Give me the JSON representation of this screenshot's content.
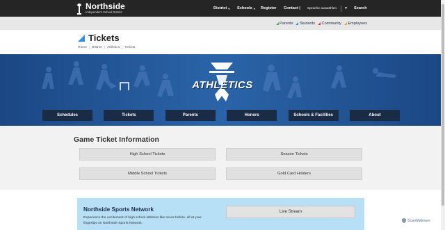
{
  "header": {
    "logo_name": "Northside",
    "logo_subtitle": "Independent School District",
    "nav": [
      {
        "label": "District",
        "has_caret": true
      },
      {
        "label": "Schools",
        "has_caret": true
      },
      {
        "label": "Register",
        "has_caret": false
      },
      {
        "label": "Contact |",
        "has_caret": false
      }
    ],
    "language_label": "Sprache auswählen",
    "language_caret": "▼",
    "search_label": "Search"
  },
  "utility_links": [
    {
      "label": "Parents",
      "color": "#4caf50"
    },
    {
      "label": "Students",
      "color": "#2f8fe0"
    },
    {
      "label": "Community",
      "color": "#e53935"
    },
    {
      "label": "Employees",
      "color": "#f4a62a"
    }
  ],
  "page": {
    "title": "Tickets",
    "breadcrumb": [
      "Home",
      "District",
      "Athletics",
      "Tickets"
    ]
  },
  "banner": {
    "logo_text": "ATHLETICS",
    "buttons": [
      "Schedules",
      "Tickets",
      "Parents",
      "Honors",
      "Schools & Facilities",
      "About"
    ]
  },
  "tickets": {
    "title": "Game Ticket Information",
    "buttons": [
      "High School Tickets",
      "Season Tickets",
      "Middle School Tickets",
      "Gold Card Holders"
    ]
  },
  "network": {
    "title": "Northside Sports Network",
    "description": "Experience the excitement of high school athletics like never before, all at your fingertips on Northside Sports Network.",
    "button": "Live Stream"
  },
  "watermark": "ScanMalware",
  "colors": {
    "topbar": "#252525",
    "banner": "#1f4e8f",
    "banner_button": "#1a2b46",
    "network_bg": "#b7e0f7",
    "title_accent": "#2f8fe0"
  }
}
